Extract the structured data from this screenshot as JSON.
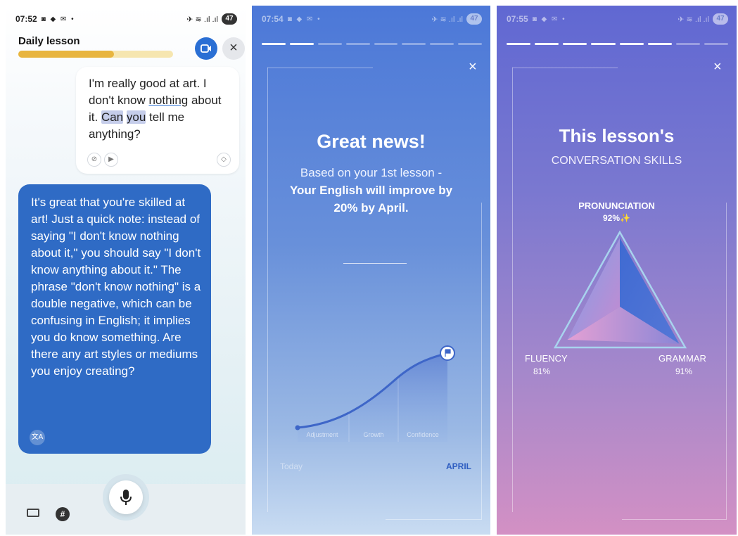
{
  "panel1": {
    "status": {
      "time": "07:52",
      "icons": "◙ ◆ ✉ •",
      "right_icons": "✈ ≋ .ıl .ıl",
      "battery": "47"
    },
    "header": {
      "title": "Daily lesson",
      "progress_percent": 62
    },
    "user_message": {
      "p1": "I'm really good at art. I don't know ",
      "p2": "nothing",
      "p3": " about it. ",
      "p4": "Can",
      "p5": " ",
      "p6": "you",
      "p7": " tell me anything?"
    },
    "bot_message": "It's great that you're skilled at art! Just a quick note: instead of saying \"I don't know nothing about it,\" you should say \"I don't know anything about it.\" The phrase \"don't know nothing\" is a double negative, which can be confusing in English; it implies you do know something. Are there any art styles or mediums you enjoy creating?",
    "icons": {
      "translate": "文A",
      "hash": "#"
    }
  },
  "panel2": {
    "status": {
      "time": "07:54",
      "icons": "◙ ◆ ✉ •",
      "right_icons": "✈ ≋ .ıl .ıl",
      "battery": "47"
    },
    "steps_total": 8,
    "steps_done": 2,
    "close": "×",
    "title": "Great news!",
    "subtitle_line": "Based on your 1st lesson -",
    "subtitle_bold": "Your English will improve by 20% by April.",
    "chart_labels": [
      "Adjustment",
      "Growth",
      "Confidence"
    ],
    "start_label": "Today",
    "end_label": "APRIL"
  },
  "panel3": {
    "status": {
      "time": "07:55",
      "icons": "◙ ◆ ✉ •",
      "right_icons": "✈ ≋ .ıl .ıl",
      "battery": "47"
    },
    "steps_total": 8,
    "steps_done": 6,
    "close": "×",
    "title": "This lesson's",
    "subtitle": "CONVERSATION SKILLS",
    "skills": {
      "pronunciation": {
        "label": "PRONUNCIATION",
        "value": "92%",
        "sparkle": "✨"
      },
      "fluency": {
        "label": "FLUENCY",
        "value": "81%"
      },
      "grammar": {
        "label": "GRAMMAR",
        "value": "91%"
      }
    }
  }
}
